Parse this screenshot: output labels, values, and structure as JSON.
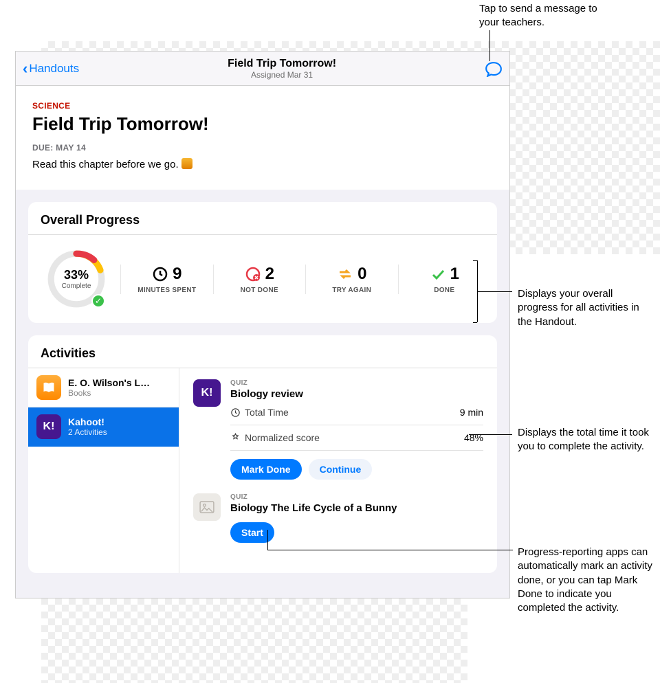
{
  "callouts": {
    "top": "Tap to send a message to your teachers.",
    "progress": "Displays your overall progress for all activities in the Handout.",
    "time": "Displays the total time it took you to complete the activity.",
    "mark": "Progress-reporting apps can automatically mark an activity done, or you can tap Mark Done to indicate you completed the activity."
  },
  "navbar": {
    "back": "Handouts",
    "title": "Field Trip Tomorrow!",
    "subtitle": "Assigned Mar 31"
  },
  "handout": {
    "subject": "SCIENCE",
    "title": "Field Trip Tomorrow!",
    "due": "DUE: MAY 14",
    "desc": "Read this chapter before we go."
  },
  "progress": {
    "header": "Overall Progress",
    "ring_pct": "33%",
    "ring_label": "Complete",
    "stats": {
      "minutes": {
        "value": "9",
        "label": "MINUTES SPENT"
      },
      "notdone": {
        "value": "2",
        "label": "NOT DONE"
      },
      "tryagain": {
        "value": "0",
        "label": "TRY AGAIN"
      },
      "done": {
        "value": "1",
        "label": "DONE"
      }
    }
  },
  "activities": {
    "header": "Activities",
    "list": [
      {
        "name": "E. O. Wilson's L…",
        "sub": "Books"
      },
      {
        "name": "Kahoot!",
        "sub": "2 Activities"
      }
    ],
    "detail": {
      "quiz1": {
        "tag": "QUIZ",
        "title": "Biology review",
        "metrics": {
          "time_label": "Total Time",
          "time_value": "9 min",
          "score_label": "Normalized score",
          "score_value": "48%"
        },
        "btn_mark": "Mark Done",
        "btn_continue": "Continue"
      },
      "quiz2": {
        "tag": "QUIZ",
        "title": "Biology The Life Cycle of a Bunny",
        "btn_start": "Start"
      }
    }
  }
}
